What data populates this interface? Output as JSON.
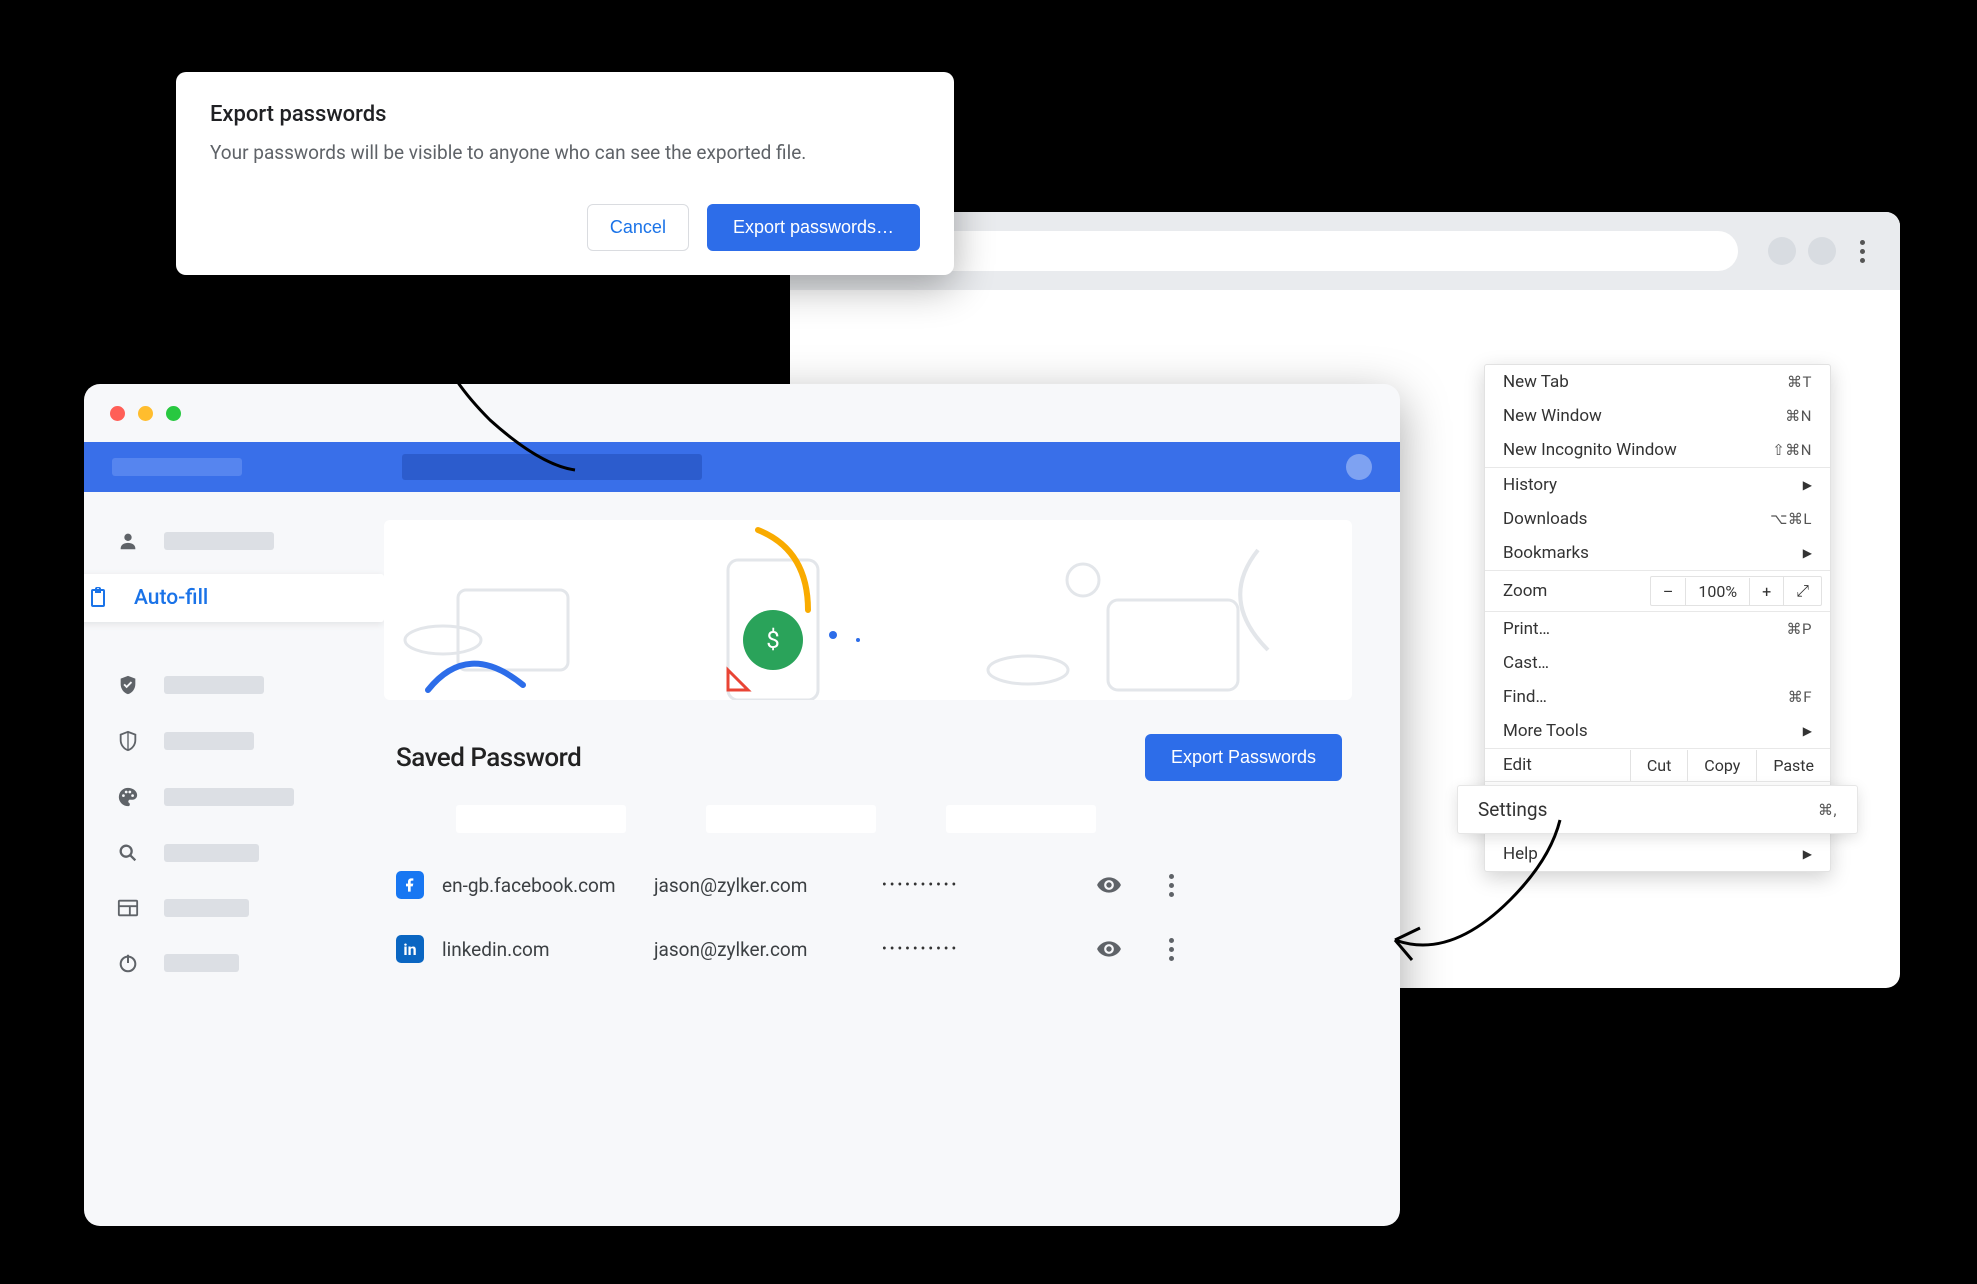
{
  "dialog": {
    "title": "Export passwords",
    "body": "Your passwords will be visible to anyone who can see the exported file.",
    "cancel": "Cancel",
    "confirm": "Export passwords…"
  },
  "menu": {
    "new_tab": "New Tab",
    "new_tab_sc": "⌘T",
    "new_window": "New Window",
    "new_window_sc": "⌘N",
    "new_incognito": "New Incognito Window",
    "new_incognito_sc": "⇧⌘N",
    "history": "History",
    "downloads": "Downloads",
    "downloads_sc": "⌥⌘L",
    "bookmarks": "Bookmarks",
    "zoom": "Zoom",
    "zoom_minus": "–",
    "zoom_value": "100%",
    "zoom_plus": "+",
    "zoom_full": "⤢",
    "print": "Print…",
    "print_sc": "⌘P",
    "cast": "Cast…",
    "find": "Find…",
    "find_sc": "⌘F",
    "more_tools": "More Tools",
    "edit": "Edit",
    "cut": "Cut",
    "copy": "Copy",
    "paste": "Paste",
    "settings": "Settings",
    "settings_sc": "⌘,",
    "help": "Help"
  },
  "sidebar": {
    "autofill": "Auto-fill"
  },
  "passwords": {
    "heading": "Saved Password",
    "export_button": "Export Passwords",
    "rows": [
      {
        "icon": "fb",
        "site": "en-gb.facebook.com",
        "user": "jason@zylker.com",
        "pwd": "••••••••••"
      },
      {
        "icon": "li",
        "site": "linkedin.com",
        "user": "jason@zylker.com",
        "pwd": "••••••••••"
      }
    ]
  }
}
